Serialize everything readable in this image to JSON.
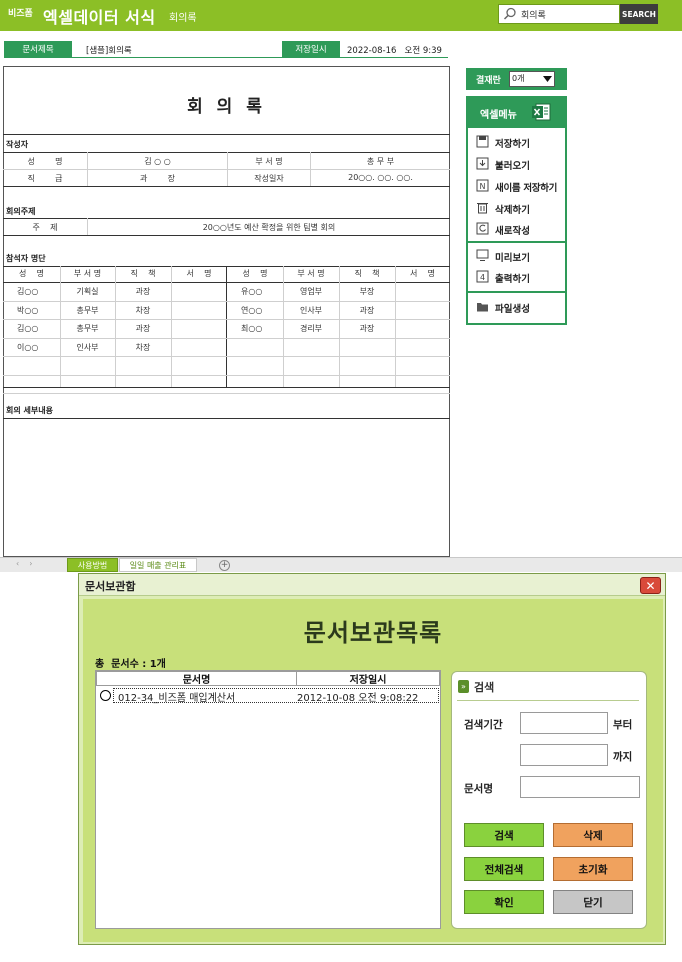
{
  "header": {
    "brand": "비즈폼",
    "app_title": "엑셀데이터 서식",
    "doc_subtitle": "회의록",
    "search_value": "회의록",
    "search_button": "SEARCH"
  },
  "doc_info": {
    "title_label": "문서제목",
    "title_value": "[샘플]회의록",
    "saved_label": "저장일시",
    "saved_value": "2022-08-16   오전 9:39"
  },
  "document": {
    "heading": "회 의 록",
    "author_section": {
      "title": "작성자",
      "rows": [
        [
          "성        명",
          "김 ○ ○",
          "부 서 명",
          "총 무 부"
        ],
        [
          "직        급",
          "과        장",
          "작성일자",
          "20○○. ○○. ○○."
        ]
      ]
    },
    "topic_section": {
      "title": "회의주제",
      "label": "주    제",
      "value": "20○○년도 예산 확정을 위한 팀별 회의"
    },
    "attendees_section": {
      "title": "참석자 명단",
      "headers": [
        "성    명",
        "부 서 명",
        "직    책",
        "서    명",
        "성    명",
        "부 서 명",
        "직    책",
        "서    명"
      ],
      "rows": [
        [
          "김○○",
          "기획실",
          "과장",
          "",
          "유○○",
          "영업부",
          "부장",
          ""
        ],
        [
          "박○○",
          "총무부",
          "차장",
          "",
          "연○○",
          "인사부",
          "과장",
          ""
        ],
        [
          "김○○",
          "총무부",
          "과장",
          "",
          "최○○",
          "경리부",
          "과장",
          ""
        ],
        [
          "이○○",
          "인사부",
          "차장",
          "",
          "",
          "",
          "",
          ""
        ]
      ]
    },
    "details_section": {
      "title": "회의 세부내용"
    }
  },
  "right_menu": {
    "approval_label": "결재란",
    "approval_value": "0개",
    "menu_title": "엑셀메뉴",
    "items": [
      {
        "label": "저장하기",
        "icon": "save-icon"
      },
      {
        "label": "불러오기",
        "icon": "load-icon"
      },
      {
        "label": "새이름 저장하기",
        "icon": "save-as-icon"
      },
      {
        "label": "삭제하기",
        "icon": "trash-icon"
      },
      {
        "label": "새로작성",
        "icon": "new-doc-icon"
      },
      {
        "label": "미리보기",
        "icon": "preview-icon"
      },
      {
        "label": "출력하기",
        "icon": "print-icon"
      },
      {
        "label": "파일생성",
        "icon": "folder-icon"
      }
    ]
  },
  "sheet_tabs": {
    "tabs": [
      "사용방법",
      "일일 매출 관리표"
    ]
  },
  "dialog": {
    "title": "문서보관함",
    "heading": "문서보관목록",
    "total_count": "총  문서수 : 1개",
    "list_headers": [
      "문서명",
      "저장일시"
    ],
    "rows": [
      {
        "name": "012-34_비즈폼 매입계산서",
        "saved": "2012-10-08 오전 9:08:22"
      }
    ],
    "search": {
      "title": "검색",
      "period_label": "검색기간",
      "from_suffix": "부터",
      "to_suffix": "까지",
      "name_label": "문서명"
    },
    "buttons": {
      "search": "검색",
      "delete": "삭제",
      "search_all": "전체검색",
      "reset": "초기화",
      "confirm": "확인",
      "close": "닫기"
    }
  },
  "colors": {
    "header_green": "#8cbf26",
    "accent_green": "#2e9a58",
    "button_green": "#8ad23e",
    "button_orange": "#f0a25e",
    "close_red": "#d94a3a"
  }
}
